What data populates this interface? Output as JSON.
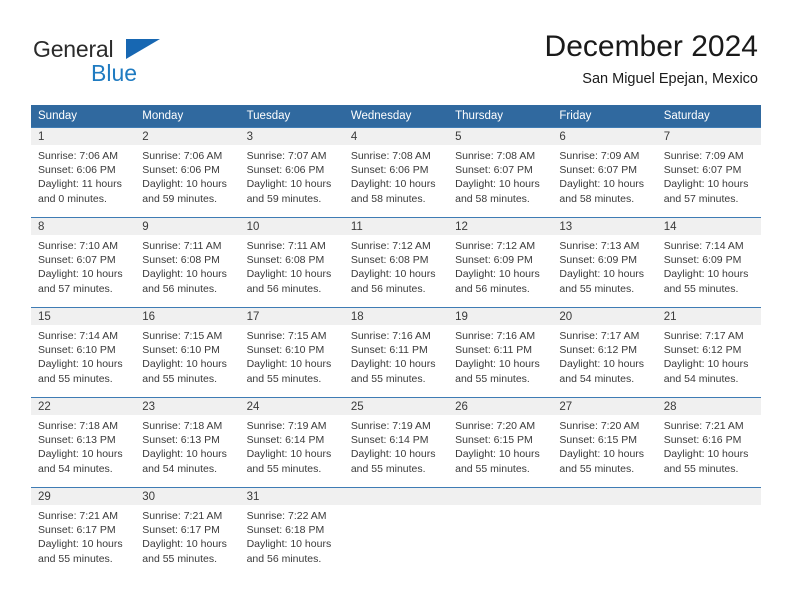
{
  "brand": {
    "word1": "General",
    "word2": "Blue",
    "triangle_color": "#1767b2",
    "word2_color": "#1f7bc1"
  },
  "header": {
    "title": "December 2024",
    "subtitle": "San Miguel Epejan, Mexico"
  },
  "theme": {
    "header_bg": "#30699f",
    "daynum_bg": "#f0f0f0",
    "rule_color": "#3f7cb4"
  },
  "weekday_headers": [
    "Sunday",
    "Monday",
    "Tuesday",
    "Wednesday",
    "Thursday",
    "Friday",
    "Saturday"
  ],
  "labels": {
    "sunrise_prefix": "Sunrise: ",
    "sunset_prefix": "Sunset: ",
    "daylight_prefix": "Daylight: "
  },
  "weeks": [
    [
      {
        "day": "1",
        "sunrise": "Sunrise: 7:06 AM",
        "sunset": "Sunset: 6:06 PM",
        "daylight1": "Daylight: 11 hours",
        "daylight2": "and 0 minutes."
      },
      {
        "day": "2",
        "sunrise": "Sunrise: 7:06 AM",
        "sunset": "Sunset: 6:06 PM",
        "daylight1": "Daylight: 10 hours",
        "daylight2": "and 59 minutes."
      },
      {
        "day": "3",
        "sunrise": "Sunrise: 7:07 AM",
        "sunset": "Sunset: 6:06 PM",
        "daylight1": "Daylight: 10 hours",
        "daylight2": "and 59 minutes."
      },
      {
        "day": "4",
        "sunrise": "Sunrise: 7:08 AM",
        "sunset": "Sunset: 6:06 PM",
        "daylight1": "Daylight: 10 hours",
        "daylight2": "and 58 minutes."
      },
      {
        "day": "5",
        "sunrise": "Sunrise: 7:08 AM",
        "sunset": "Sunset: 6:07 PM",
        "daylight1": "Daylight: 10 hours",
        "daylight2": "and 58 minutes."
      },
      {
        "day": "6",
        "sunrise": "Sunrise: 7:09 AM",
        "sunset": "Sunset: 6:07 PM",
        "daylight1": "Daylight: 10 hours",
        "daylight2": "and 58 minutes."
      },
      {
        "day": "7",
        "sunrise": "Sunrise: 7:09 AM",
        "sunset": "Sunset: 6:07 PM",
        "daylight1": "Daylight: 10 hours",
        "daylight2": "and 57 minutes."
      }
    ],
    [
      {
        "day": "8",
        "sunrise": "Sunrise: 7:10 AM",
        "sunset": "Sunset: 6:07 PM",
        "daylight1": "Daylight: 10 hours",
        "daylight2": "and 57 minutes."
      },
      {
        "day": "9",
        "sunrise": "Sunrise: 7:11 AM",
        "sunset": "Sunset: 6:08 PM",
        "daylight1": "Daylight: 10 hours",
        "daylight2": "and 56 minutes."
      },
      {
        "day": "10",
        "sunrise": "Sunrise: 7:11 AM",
        "sunset": "Sunset: 6:08 PM",
        "daylight1": "Daylight: 10 hours",
        "daylight2": "and 56 minutes."
      },
      {
        "day": "11",
        "sunrise": "Sunrise: 7:12 AM",
        "sunset": "Sunset: 6:08 PM",
        "daylight1": "Daylight: 10 hours",
        "daylight2": "and 56 minutes."
      },
      {
        "day": "12",
        "sunrise": "Sunrise: 7:12 AM",
        "sunset": "Sunset: 6:09 PM",
        "daylight1": "Daylight: 10 hours",
        "daylight2": "and 56 minutes."
      },
      {
        "day": "13",
        "sunrise": "Sunrise: 7:13 AM",
        "sunset": "Sunset: 6:09 PM",
        "daylight1": "Daylight: 10 hours",
        "daylight2": "and 55 minutes."
      },
      {
        "day": "14",
        "sunrise": "Sunrise: 7:14 AM",
        "sunset": "Sunset: 6:09 PM",
        "daylight1": "Daylight: 10 hours",
        "daylight2": "and 55 minutes."
      }
    ],
    [
      {
        "day": "15",
        "sunrise": "Sunrise: 7:14 AM",
        "sunset": "Sunset: 6:10 PM",
        "daylight1": "Daylight: 10 hours",
        "daylight2": "and 55 minutes."
      },
      {
        "day": "16",
        "sunrise": "Sunrise: 7:15 AM",
        "sunset": "Sunset: 6:10 PM",
        "daylight1": "Daylight: 10 hours",
        "daylight2": "and 55 minutes."
      },
      {
        "day": "17",
        "sunrise": "Sunrise: 7:15 AM",
        "sunset": "Sunset: 6:10 PM",
        "daylight1": "Daylight: 10 hours",
        "daylight2": "and 55 minutes."
      },
      {
        "day": "18",
        "sunrise": "Sunrise: 7:16 AM",
        "sunset": "Sunset: 6:11 PM",
        "daylight1": "Daylight: 10 hours",
        "daylight2": "and 55 minutes."
      },
      {
        "day": "19",
        "sunrise": "Sunrise: 7:16 AM",
        "sunset": "Sunset: 6:11 PM",
        "daylight1": "Daylight: 10 hours",
        "daylight2": "and 55 minutes."
      },
      {
        "day": "20",
        "sunrise": "Sunrise: 7:17 AM",
        "sunset": "Sunset: 6:12 PM",
        "daylight1": "Daylight: 10 hours",
        "daylight2": "and 54 minutes."
      },
      {
        "day": "21",
        "sunrise": "Sunrise: 7:17 AM",
        "sunset": "Sunset: 6:12 PM",
        "daylight1": "Daylight: 10 hours",
        "daylight2": "and 54 minutes."
      }
    ],
    [
      {
        "day": "22",
        "sunrise": "Sunrise: 7:18 AM",
        "sunset": "Sunset: 6:13 PM",
        "daylight1": "Daylight: 10 hours",
        "daylight2": "and 54 minutes."
      },
      {
        "day": "23",
        "sunrise": "Sunrise: 7:18 AM",
        "sunset": "Sunset: 6:13 PM",
        "daylight1": "Daylight: 10 hours",
        "daylight2": "and 54 minutes."
      },
      {
        "day": "24",
        "sunrise": "Sunrise: 7:19 AM",
        "sunset": "Sunset: 6:14 PM",
        "daylight1": "Daylight: 10 hours",
        "daylight2": "and 55 minutes."
      },
      {
        "day": "25",
        "sunrise": "Sunrise: 7:19 AM",
        "sunset": "Sunset: 6:14 PM",
        "daylight1": "Daylight: 10 hours",
        "daylight2": "and 55 minutes."
      },
      {
        "day": "26",
        "sunrise": "Sunrise: 7:20 AM",
        "sunset": "Sunset: 6:15 PM",
        "daylight1": "Daylight: 10 hours",
        "daylight2": "and 55 minutes."
      },
      {
        "day": "27",
        "sunrise": "Sunrise: 7:20 AM",
        "sunset": "Sunset: 6:15 PM",
        "daylight1": "Daylight: 10 hours",
        "daylight2": "and 55 minutes."
      },
      {
        "day": "28",
        "sunrise": "Sunrise: 7:21 AM",
        "sunset": "Sunset: 6:16 PM",
        "daylight1": "Daylight: 10 hours",
        "daylight2": "and 55 minutes."
      }
    ],
    [
      {
        "day": "29",
        "sunrise": "Sunrise: 7:21 AM",
        "sunset": "Sunset: 6:17 PM",
        "daylight1": "Daylight: 10 hours",
        "daylight2": "and 55 minutes."
      },
      {
        "day": "30",
        "sunrise": "Sunrise: 7:21 AM",
        "sunset": "Sunset: 6:17 PM",
        "daylight1": "Daylight: 10 hours",
        "daylight2": "and 55 minutes."
      },
      {
        "day": "31",
        "sunrise": "Sunrise: 7:22 AM",
        "sunset": "Sunset: 6:18 PM",
        "daylight1": "Daylight: 10 hours",
        "daylight2": "and 56 minutes."
      },
      {
        "day": "",
        "sunrise": "",
        "sunset": "",
        "daylight1": "",
        "daylight2": ""
      },
      {
        "day": "",
        "sunrise": "",
        "sunset": "",
        "daylight1": "",
        "daylight2": ""
      },
      {
        "day": "",
        "sunrise": "",
        "sunset": "",
        "daylight1": "",
        "daylight2": ""
      },
      {
        "day": "",
        "sunrise": "",
        "sunset": "",
        "daylight1": "",
        "daylight2": ""
      }
    ]
  ]
}
